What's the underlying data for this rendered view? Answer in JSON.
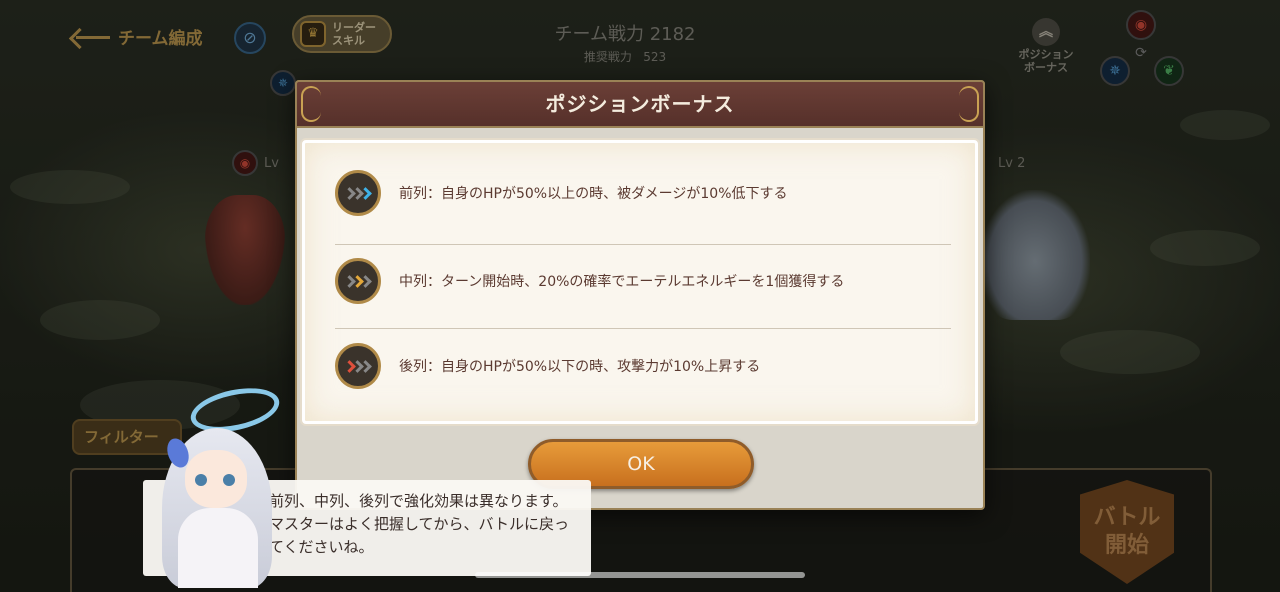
{
  "header": {
    "back_label": "チーム編成",
    "leader_skill_label": "リーダー\nスキル",
    "team_power_label": "チーム戦力",
    "team_power_value": "2182",
    "recommended_power_label": "推奨戦力",
    "recommended_power_value": "523",
    "position_bonus_label": "ポジション\nボーナス"
  },
  "scene": {
    "left_level": "Lv",
    "right_level": "Lv 2",
    "filter_label": "フィルター",
    "battle_label": "バトル\n開始"
  },
  "dialog": {
    "title": "ポジションボーナス",
    "rows": [
      {
        "icon": "front-row-chevron-icon",
        "text": "前列：自身のHPが50%以上の時、被ダメージが10%低下する"
      },
      {
        "icon": "middle-row-chevron-icon",
        "text": "中列：ターン開始時、20%の確率でエーテルエネルギーを1個獲得する"
      },
      {
        "icon": "back-row-chevron-icon",
        "text": "後列：自身のHPが50%以下の時、攻撃力が10%上昇する"
      }
    ],
    "ok_label": "OK"
  },
  "tutorial": {
    "speech": "前列、中列、後列で強化効果は異なります。マスターはよく把握してから、バトルに戻ってくださいね。"
  },
  "colors": {
    "dialog_header": "#5e352e",
    "ok_button": "#d9842a",
    "accent_gold": "#c9a253",
    "front_accent": "#3fb2e8",
    "middle_accent": "#e3a83a",
    "back_accent": "#e0503c"
  }
}
